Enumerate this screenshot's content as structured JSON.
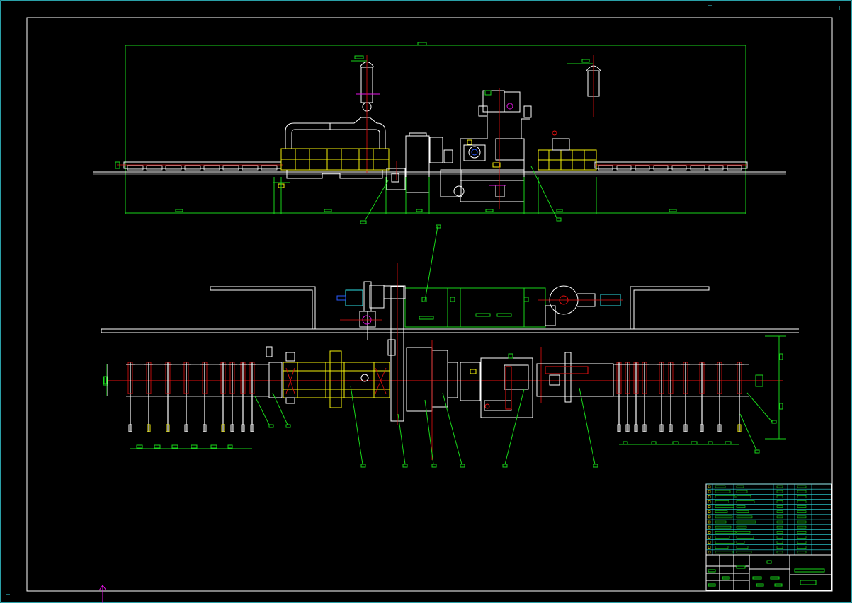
{
  "canvas": {
    "background": "#000000"
  },
  "palette": {
    "frame": "#39d5df",
    "white": "#ffffff",
    "green": "#19d51a",
    "yellow": "#f3f10a",
    "red": "#e60f0f",
    "magenta": "#e612e6",
    "cyan": "#2ee0e6",
    "blue": "#2a5bff"
  },
  "drawing": {
    "sheet": "cad-layout-drawing",
    "views": [
      "front-elevation",
      "plan-view"
    ],
    "title_block_rows": 14
  }
}
